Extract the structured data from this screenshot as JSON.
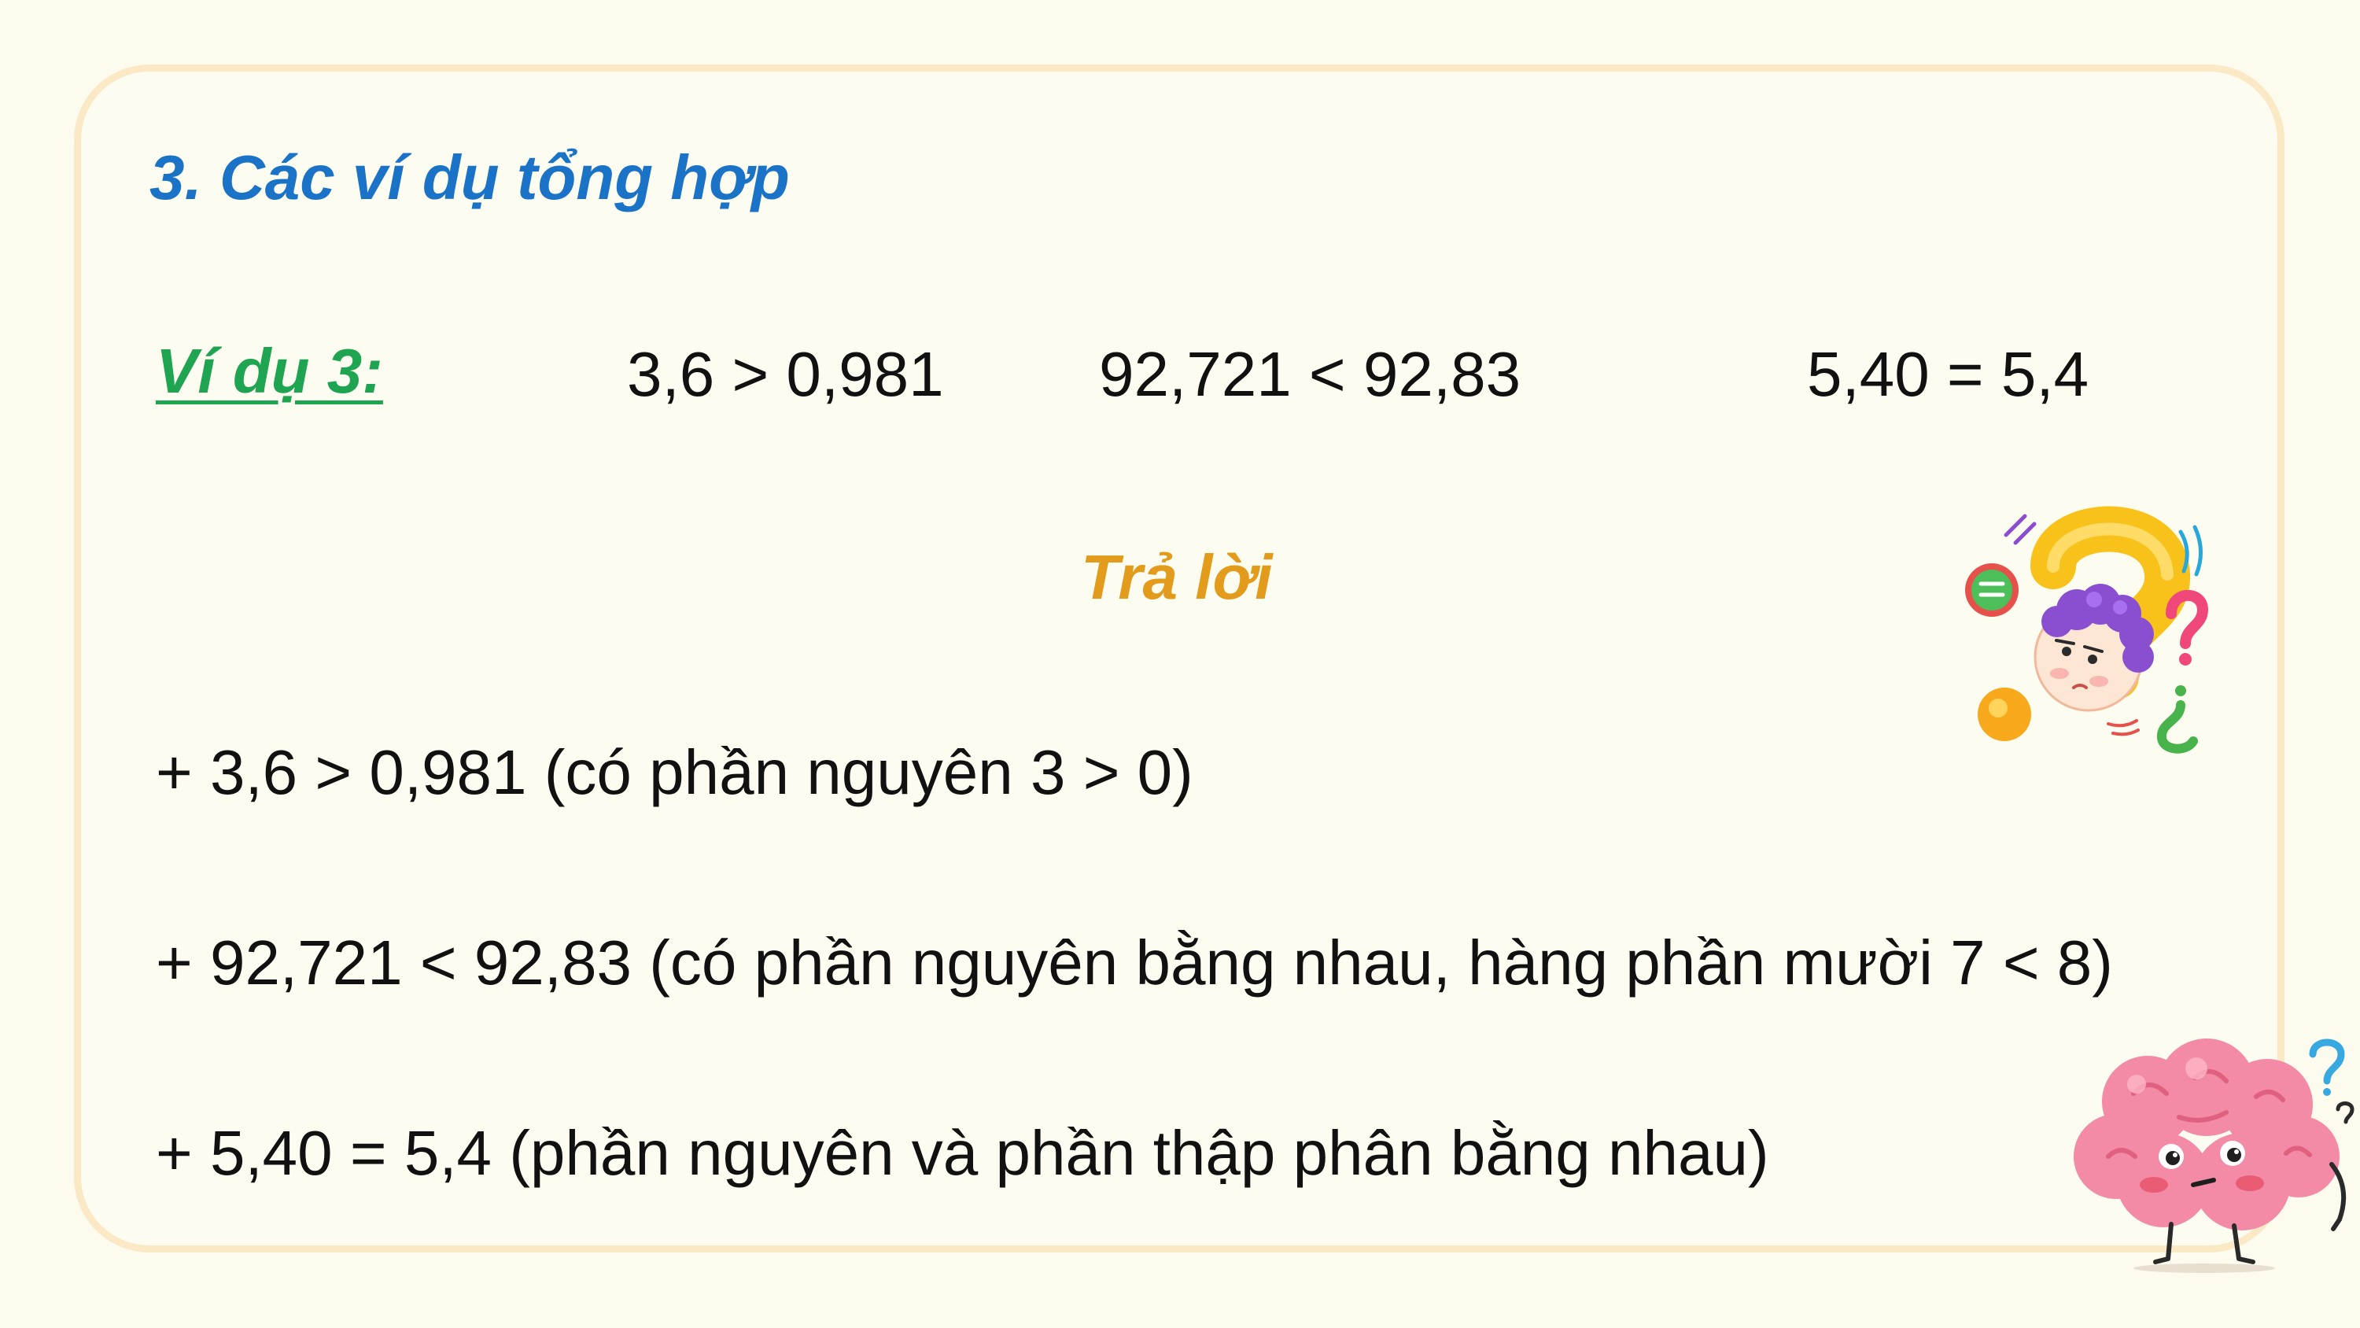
{
  "section_title": "3. Các ví dụ tổng hợp",
  "example": {
    "label": "Ví dụ 3:",
    "expressions": [
      "3,6 > 0,981",
      "92,721 < 92,83",
      "5,40 = 5,4"
    ]
  },
  "answer": {
    "heading": "Trả lời",
    "lines": [
      "+ 3,6 > 0,981 (có phần nguyên 3 > 0)",
      "+ 92,721 < 92,83 (có phần nguyên bằng nhau, hàng phần mười 7 < 8)",
      "+ 5,40 = 5,4 (phần nguyên và phần thập phân bằng nhau)"
    ]
  },
  "colors": {
    "title": "#1a73c6",
    "example_label": "#1fa552",
    "answer_heading": "#e39b1b",
    "card_border": "#fbe8c4",
    "background": "#fdfbee"
  },
  "illustrations": [
    "question-mark-kid-icon",
    "confused-brain-icon"
  ]
}
